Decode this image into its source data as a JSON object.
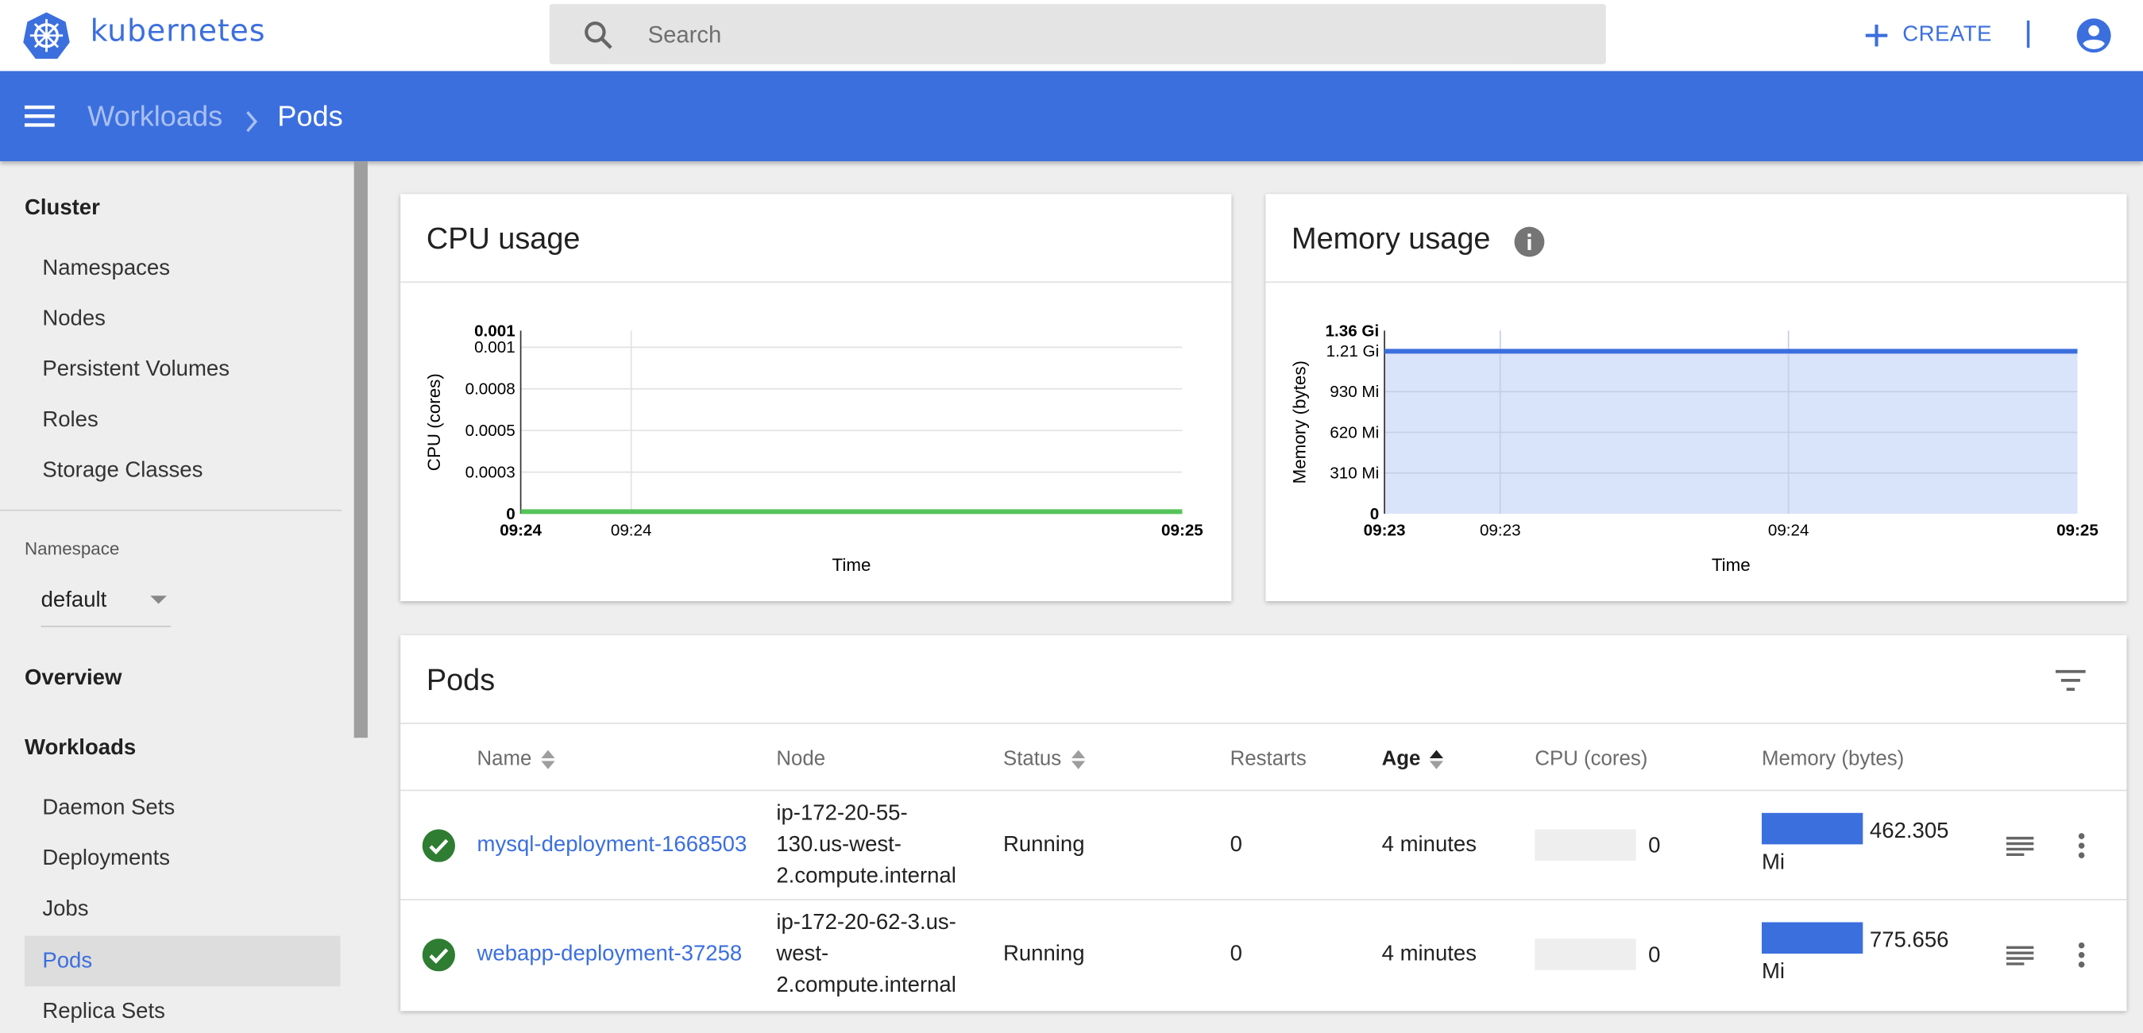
{
  "header": {
    "brand": "kubernetes",
    "search_placeholder": "Search",
    "create_label": "CREATE"
  },
  "breadcrumb": {
    "parent": "Workloads",
    "separator": ">",
    "current": "Pods"
  },
  "sidebar": {
    "cluster_heading": "Cluster",
    "cluster_items": [
      "Namespaces",
      "Nodes",
      "Persistent Volumes",
      "Roles",
      "Storage Classes"
    ],
    "namespace_label": "Namespace",
    "namespace_value": "default",
    "overview": "Overview",
    "workloads_heading": "Workloads",
    "workload_items": [
      "Daemon Sets",
      "Deployments",
      "Jobs",
      "Pods",
      "Replica Sets"
    ],
    "active_item": "Pods"
  },
  "cpu_card": {
    "title": "CPU usage"
  },
  "memory_card": {
    "title": "Memory usage",
    "info_icon": "info-icon"
  },
  "chart_data": [
    {
      "type": "line",
      "title": "CPU usage",
      "xlabel": "Time",
      "ylabel": "CPU (cores)",
      "ytick_labels": [
        "0",
        "0.0003",
        "0.0005",
        "0.0008",
        "0.001",
        "0.001"
      ],
      "ytick_values": [
        0,
        0.00025,
        0.0005,
        0.00075,
        0.001,
        0.0011
      ],
      "xtick_labels": [
        "09:24",
        "09:24",
        "09:25"
      ],
      "xtick_positions": [
        0,
        0.167,
        1
      ],
      "ylim": [
        0,
        0.0011
      ],
      "grid": true,
      "color": "#56c35a",
      "series": [
        {
          "x": [
            "09:24",
            "09:25"
          ],
          "values": [
            0,
            0
          ]
        }
      ]
    },
    {
      "type": "area",
      "title": "Memory usage",
      "xlabel": "Time",
      "ylabel": "Memory (bytes)",
      "ytick_labels": [
        "0",
        "310 Mi",
        "620 Mi",
        "930 Mi",
        "1.21 Gi",
        "1.36 Gi"
      ],
      "ytick_values_mi": [
        0,
        310,
        620,
        930,
        1240,
        1395
      ],
      "xtick_labels": [
        "09:23",
        "09:23",
        "09:24",
        "09:25"
      ],
      "xtick_positions": [
        0,
        0.167,
        0.583,
        1
      ],
      "ylim_mi": [
        0,
        1395
      ],
      "grid": true,
      "color": "#3c6fde",
      "fill": "#d9e3f9",
      "series": [
        {
          "x": [
            "09:23",
            "09:25"
          ],
          "values_mi": [
            1238,
            1238
          ]
        }
      ]
    }
  ],
  "pods": {
    "title": "Pods",
    "columns": [
      "Name",
      "Node",
      "Status",
      "Restarts",
      "Age",
      "CPU (cores)",
      "Memory (bytes)"
    ],
    "sorted_column": "Age",
    "rows": [
      {
        "name": "mysql-deployment-1668503",
        "node": [
          "ip-172-20-55-",
          "130.us-west-",
          "2.compute.internal"
        ],
        "status": "Running",
        "restarts": "0",
        "age": "4 minutes",
        "cpu": "0",
        "memory": "462.305",
        "memory_unit": "Mi",
        "memory_fraction": 1.0,
        "cpu_fraction": 0,
        "status_color": "#2e7d32"
      },
      {
        "name": "webapp-deployment-37258",
        "node": [
          "ip-172-20-62-3.us-",
          "west-",
          "2.compute.internal"
        ],
        "status": "Running",
        "restarts": "0",
        "age": "4 minutes",
        "cpu": "0",
        "memory": "775.656",
        "memory_unit": "Mi",
        "memory_fraction": 1.0,
        "cpu_fraction": 0,
        "status_color": "#2e7d32"
      }
    ]
  }
}
